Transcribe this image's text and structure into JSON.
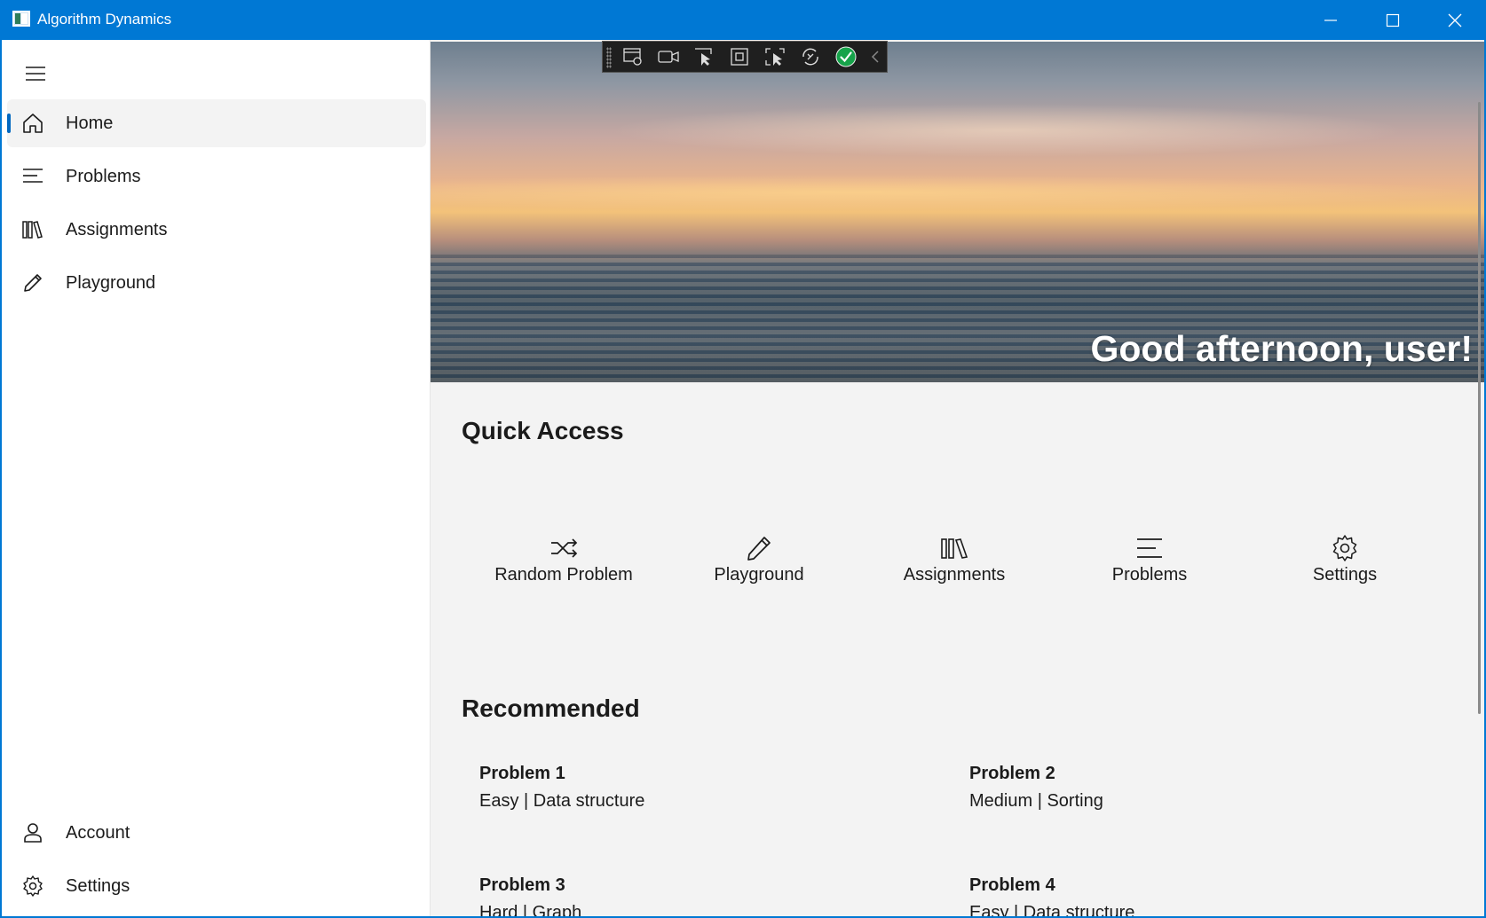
{
  "window": {
    "title": "Algorithm Dynamics"
  },
  "sidebar": {
    "items": [
      {
        "label": "Home",
        "icon": "home-icon"
      },
      {
        "label": "Problems",
        "icon": "list-icon"
      },
      {
        "label": "Assignments",
        "icon": "library-icon"
      },
      {
        "label": "Playground",
        "icon": "pencil-icon"
      }
    ],
    "footer": [
      {
        "label": "Account",
        "icon": "person-icon"
      },
      {
        "label": "Settings",
        "icon": "gear-icon"
      }
    ],
    "selected": "Home"
  },
  "hero": {
    "greeting": "Good afternoon, user!"
  },
  "quick_access": {
    "title": "Quick Access",
    "items": [
      {
        "label": "Random Problem",
        "icon": "shuffle-icon"
      },
      {
        "label": "Playground",
        "icon": "pencil-icon"
      },
      {
        "label": "Assignments",
        "icon": "library-icon"
      },
      {
        "label": "Problems",
        "icon": "list-icon"
      },
      {
        "label": "Settings",
        "icon": "gear-icon"
      }
    ]
  },
  "recommended": {
    "title": "Recommended",
    "problems": [
      {
        "title": "Problem 1",
        "meta": "Easy | Data structure"
      },
      {
        "title": "Problem 2",
        "meta": "Medium | Sorting"
      },
      {
        "title": "Problem 3",
        "meta": "Hard | Graph"
      },
      {
        "title": "Problem 4",
        "meta": "Easy | Data structure"
      }
    ]
  },
  "colors": {
    "accent": "#0078d4",
    "nav_indicator": "#0067c0",
    "content_bg": "#f3f3f3"
  }
}
